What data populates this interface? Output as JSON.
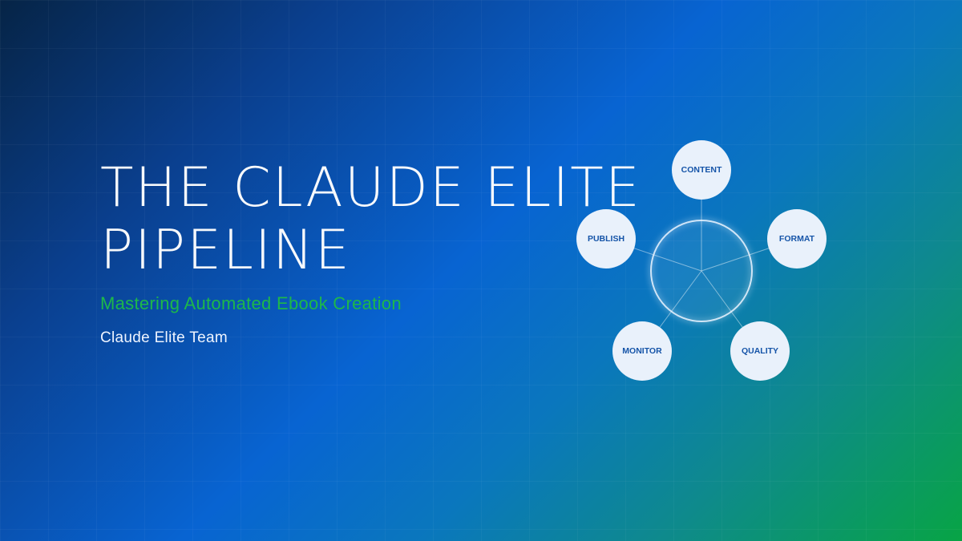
{
  "title": {
    "line1": "THE CLAUDE ELITE",
    "line2": "PIPELINE"
  },
  "subtitle": "Mastering Automated Ebook Creation",
  "author": "Claude Elite Team",
  "diagram": {
    "nodes": [
      {
        "label": "CONTENT"
      },
      {
        "label": "FORMAT"
      },
      {
        "label": "QUALITY"
      },
      {
        "label": "MONITOR"
      },
      {
        "label": "PUBLISH"
      }
    ]
  },
  "colors": {
    "subtitle": "#1db84a",
    "node_fill": "#e9f1fb",
    "node_text": "#1554a8"
  }
}
